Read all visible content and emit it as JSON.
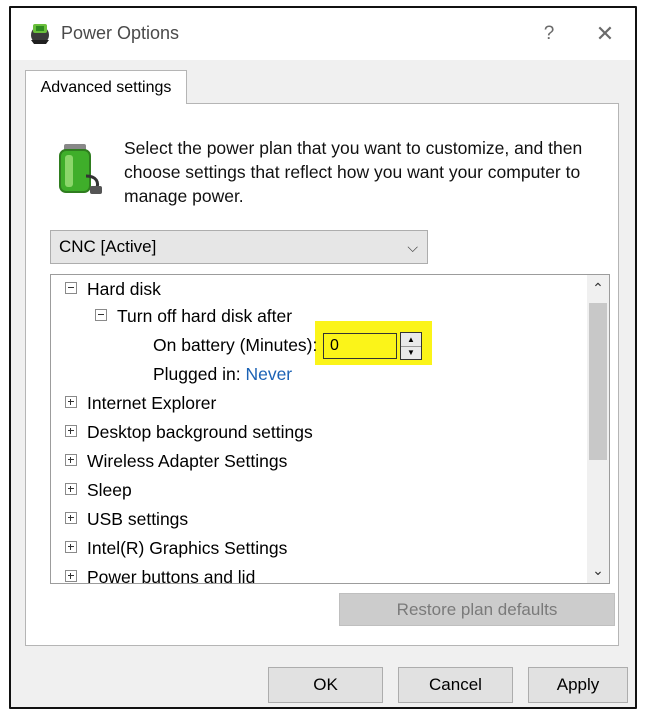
{
  "window": {
    "title": "Power Options",
    "help_glyph": "?",
    "close_glyph": "✕"
  },
  "tabs": [
    {
      "label": "Advanced settings",
      "active": true
    }
  ],
  "description": "Select the power plan that you want to customize, and then choose settings that reflect how you want your computer to manage power.",
  "plan_select": {
    "value": "CNC [Active]",
    "chevron": "⌵"
  },
  "tree": {
    "items": [
      {
        "label": "Hard disk",
        "expanded": true
      },
      {
        "label": "Turn off hard disk after",
        "expanded": true
      },
      {
        "label": "On battery (Minutes):",
        "value": "0"
      },
      {
        "label": "Plugged in:",
        "value": "Never"
      },
      {
        "label": "Internet Explorer",
        "expanded": false
      },
      {
        "label": "Desktop background settings",
        "expanded": false
      },
      {
        "label": "Wireless Adapter Settings",
        "expanded": false
      },
      {
        "label": "Sleep",
        "expanded": false
      },
      {
        "label": "USB settings",
        "expanded": false
      },
      {
        "label": "Intel(R) Graphics Settings",
        "expanded": false
      },
      {
        "label": "Power buttons and lid",
        "expanded": false
      }
    ],
    "spin_up": "▲",
    "spin_down": "▼",
    "scroll_up": "⌃",
    "scroll_down": "⌄"
  },
  "buttons": {
    "restore": "Restore plan defaults",
    "ok": "OK",
    "cancel": "Cancel",
    "apply": "Apply"
  },
  "colors": {
    "highlight": "#fbf419",
    "link": "#1b62b5",
    "battery_green": "#3fae2a"
  }
}
